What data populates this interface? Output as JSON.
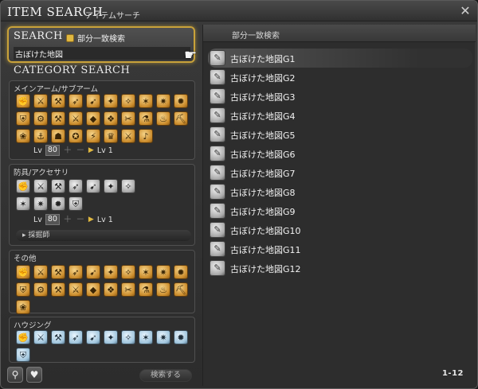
{
  "window": {
    "title": "ITEM SEARCH",
    "subtitle": "アイテムサーチ",
    "close_icon": "close-x-icon"
  },
  "search": {
    "label": "SEARCH",
    "partial_match_label": "部分一致検索",
    "partial_match_checked": true,
    "query": "古ぼけた地図"
  },
  "category": {
    "title": "CATEGORY SEARCH",
    "weapons": {
      "title": "メインアーム/サブアーム",
      "icons": [
        "pugilist-icon",
        "gladiator-icon",
        "marauder-icon",
        "lancer-icon",
        "archer-icon",
        "thaumaturge-icon",
        "conjurer-icon",
        "arcanist-icon",
        "rogue-icon",
        "machinist-icon",
        "shield-icon",
        "carpenter-icon",
        "blacksmith-icon",
        "armorer-icon",
        "goldsmith-icon",
        "leatherworker-icon",
        "weaver-icon",
        "alchemist-icon",
        "culinarian-icon",
        "miner-icon",
        "botanist-icon",
        "fisher-icon",
        "dark-knight-icon",
        "astrologian-icon",
        "samurai-icon",
        "red-mage-icon",
        "gunbreaker-icon",
        "dancer-icon"
      ],
      "lv_label": "Lv",
      "lv_value": "80",
      "lv_min": "Lv 1"
    },
    "armor": {
      "title": "防具/アクセサリ",
      "icons": [
        "head-icon",
        "body-icon",
        "hands-icon",
        "waist-icon",
        "legs-icon",
        "feet-icon",
        "earrings-icon",
        "necklace-icon",
        "bracelets-icon",
        "ring-icon",
        "soul-crystal-icon"
      ],
      "lv_label": "Lv",
      "lv_value": "80",
      "lv_min": "Lv 1",
      "sub_label": "採掘師"
    },
    "other": {
      "title": "その他",
      "icons": [
        "medicine-icon",
        "ingredient-icon",
        "meal-icon",
        "seafood-icon",
        "stone-icon",
        "metal-icon",
        "lumber-icon",
        "cloth-icon",
        "leather-icon",
        "bone-icon",
        "reagent-icon",
        "dye-icon",
        "part-icon",
        "furnishing-icon",
        "materia-icon",
        "crystal-icon",
        "catalyst-icon",
        "miscellany-icon",
        "minion-icon",
        "airship-icon",
        "orchestrion-icon"
      ]
    },
    "housing": {
      "title": "ハウジング",
      "icons": [
        "roof-icon",
        "exterior-wall-icon",
        "window-icon",
        "door-icon",
        "roof-decoration-icon",
        "exterior-decoration-icon",
        "placard-icon",
        "fence-icon",
        "interior-wall-icon",
        "flooring-icon",
        "ceiling-light-icon"
      ]
    }
  },
  "footer": {
    "search_settings_icon": "magnifier-icon",
    "favorites_icon": "heart-icon",
    "search_button": "検索する"
  },
  "results": {
    "header": "部分一致検索",
    "selected_index": 0,
    "items": [
      "古ぼけた地図G1",
      "古ぼけた地図G2",
      "古ぼけた地図G3",
      "古ぼけた地図G4",
      "古ぼけた地図G5",
      "古ぼけた地図G6",
      "古ぼけた地図G7",
      "古ぼけた地図G8",
      "古ぼけた地図G9",
      "古ぼけた地図G10",
      "古ぼけた地図G11",
      "古ぼけた地図G12"
    ],
    "range": "1-12"
  }
}
